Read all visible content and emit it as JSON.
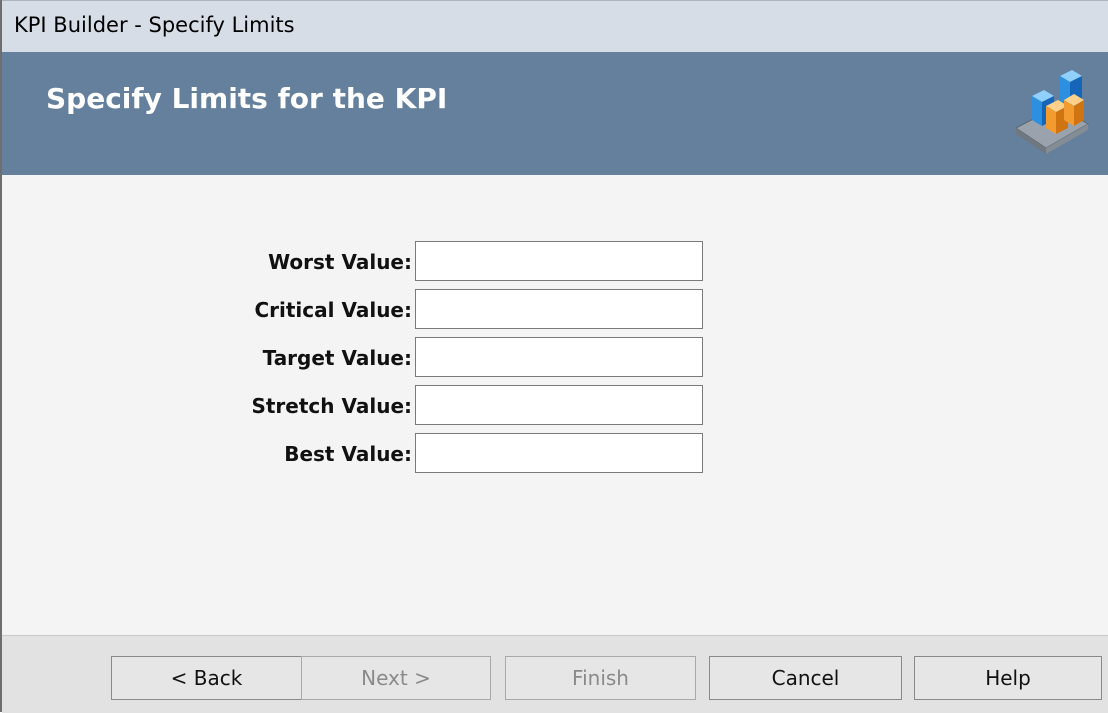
{
  "window": {
    "title": "KPI Builder - Specify Limits"
  },
  "header": {
    "heading": "Specify Limits for the KPI",
    "logo_icon": "kpi-bar-chart-icon"
  },
  "fields": [
    {
      "label": "Worst Value:",
      "value": ""
    },
    {
      "label": "Critical Value:",
      "value": ""
    },
    {
      "label": "Target Value:",
      "value": ""
    },
    {
      "label": "Stretch Value:",
      "value": ""
    },
    {
      "label": "Best Value:",
      "value": ""
    }
  ],
  "buttons": {
    "back": "< Back",
    "next": "Next >",
    "finish": "Finish",
    "cancel": "Cancel",
    "help": "Help"
  },
  "colors": {
    "header_bg": "#65809c",
    "titlebar_bg": "#d6dde6",
    "content_bg": "#f4f4f4",
    "footer_bg": "#e2e2e2"
  }
}
